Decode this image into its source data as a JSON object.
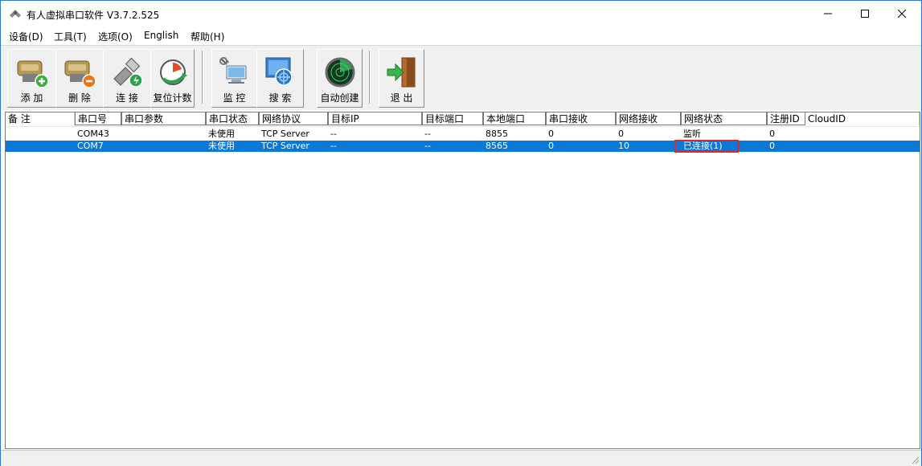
{
  "window": {
    "title": "有人虚拟串口软件 V3.7.2.525"
  },
  "menu": [
    {
      "label": "设备(D)"
    },
    {
      "label": "工具(T)"
    },
    {
      "label": "选项(O)"
    },
    {
      "label": "English"
    },
    {
      "label": "帮助(H)"
    }
  ],
  "toolbar": {
    "add": {
      "label": "添 加",
      "icon": "serial-add-icon"
    },
    "delete": {
      "label": "删 除",
      "icon": "serial-delete-icon"
    },
    "connect": {
      "label": "连 接",
      "icon": "connect-plug-icon"
    },
    "reset_count": {
      "label": "复位计数",
      "icon": "reset-gauge-icon"
    },
    "monitor": {
      "label": "监 控",
      "icon": "monitor-icon"
    },
    "search": {
      "label": "搜 索",
      "icon": "search-globe-icon"
    },
    "auto_create": {
      "label": "自动创建",
      "icon": "radar-icon"
    },
    "exit": {
      "label": "退 出",
      "icon": "exit-door-icon"
    }
  },
  "list": {
    "columns": [
      "备 注",
      "串口号",
      "串口参数",
      "串口状态",
      "网络协议",
      "目标IP",
      "目标端口",
      "本地端口",
      "串口接收",
      "网络接收",
      "网络状态",
      "注册ID",
      "CloudID"
    ],
    "rows": [
      {
        "remark": "",
        "port": "COM43",
        "params": "",
        "port_status": "未使用",
        "protocol": "TCP Server",
        "target_ip": "--",
        "target_port": "--",
        "local_port": "8855",
        "serial_rx": "0",
        "net_rx": "0",
        "net_status": "监听",
        "reg_id": "0",
        "cloud_id": "",
        "selected": false
      },
      {
        "remark": "",
        "port": "COM7",
        "params": "",
        "port_status": "未使用",
        "protocol": "TCP Server",
        "target_ip": "--",
        "target_port": "--",
        "local_port": "8565",
        "serial_rx": "0",
        "net_rx": "10",
        "net_status": "已连接(1)",
        "reg_id": "0",
        "cloud_id": "",
        "selected": true
      }
    ]
  },
  "colors": {
    "selection": "#0a78d7",
    "highlight_box": "#e0252b",
    "toolbar_bg": "#f0f0f0"
  }
}
